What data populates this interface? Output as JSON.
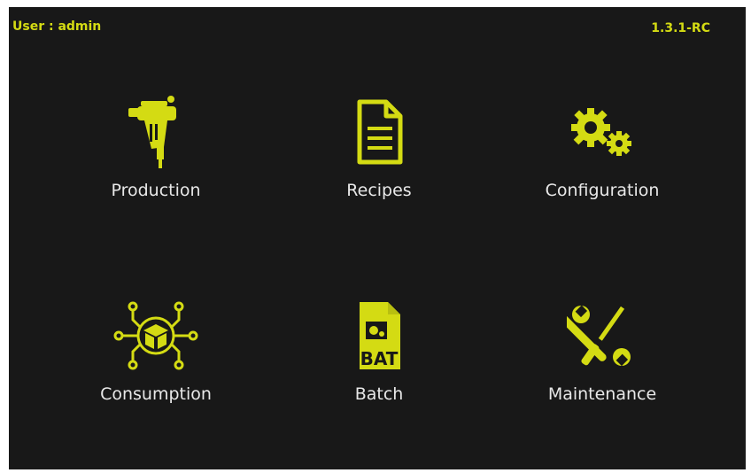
{
  "header": {
    "user": "User : admin",
    "version": "1.3.1-RC"
  },
  "colors": {
    "accent": "#d4db13",
    "background": "#181818",
    "label": "#e8e8e8"
  },
  "tiles": [
    {
      "label": "Production",
      "icon": "spray-gun-icon"
    },
    {
      "label": "Recipes",
      "icon": "document-icon"
    },
    {
      "label": "Configuration",
      "icon": "gears-icon"
    },
    {
      "label": "Consumption",
      "icon": "box-network-icon"
    },
    {
      "label": "Batch",
      "icon": "bat-file-icon"
    },
    {
      "label": "Maintenance",
      "icon": "wrench-screwdriver-icon"
    }
  ]
}
